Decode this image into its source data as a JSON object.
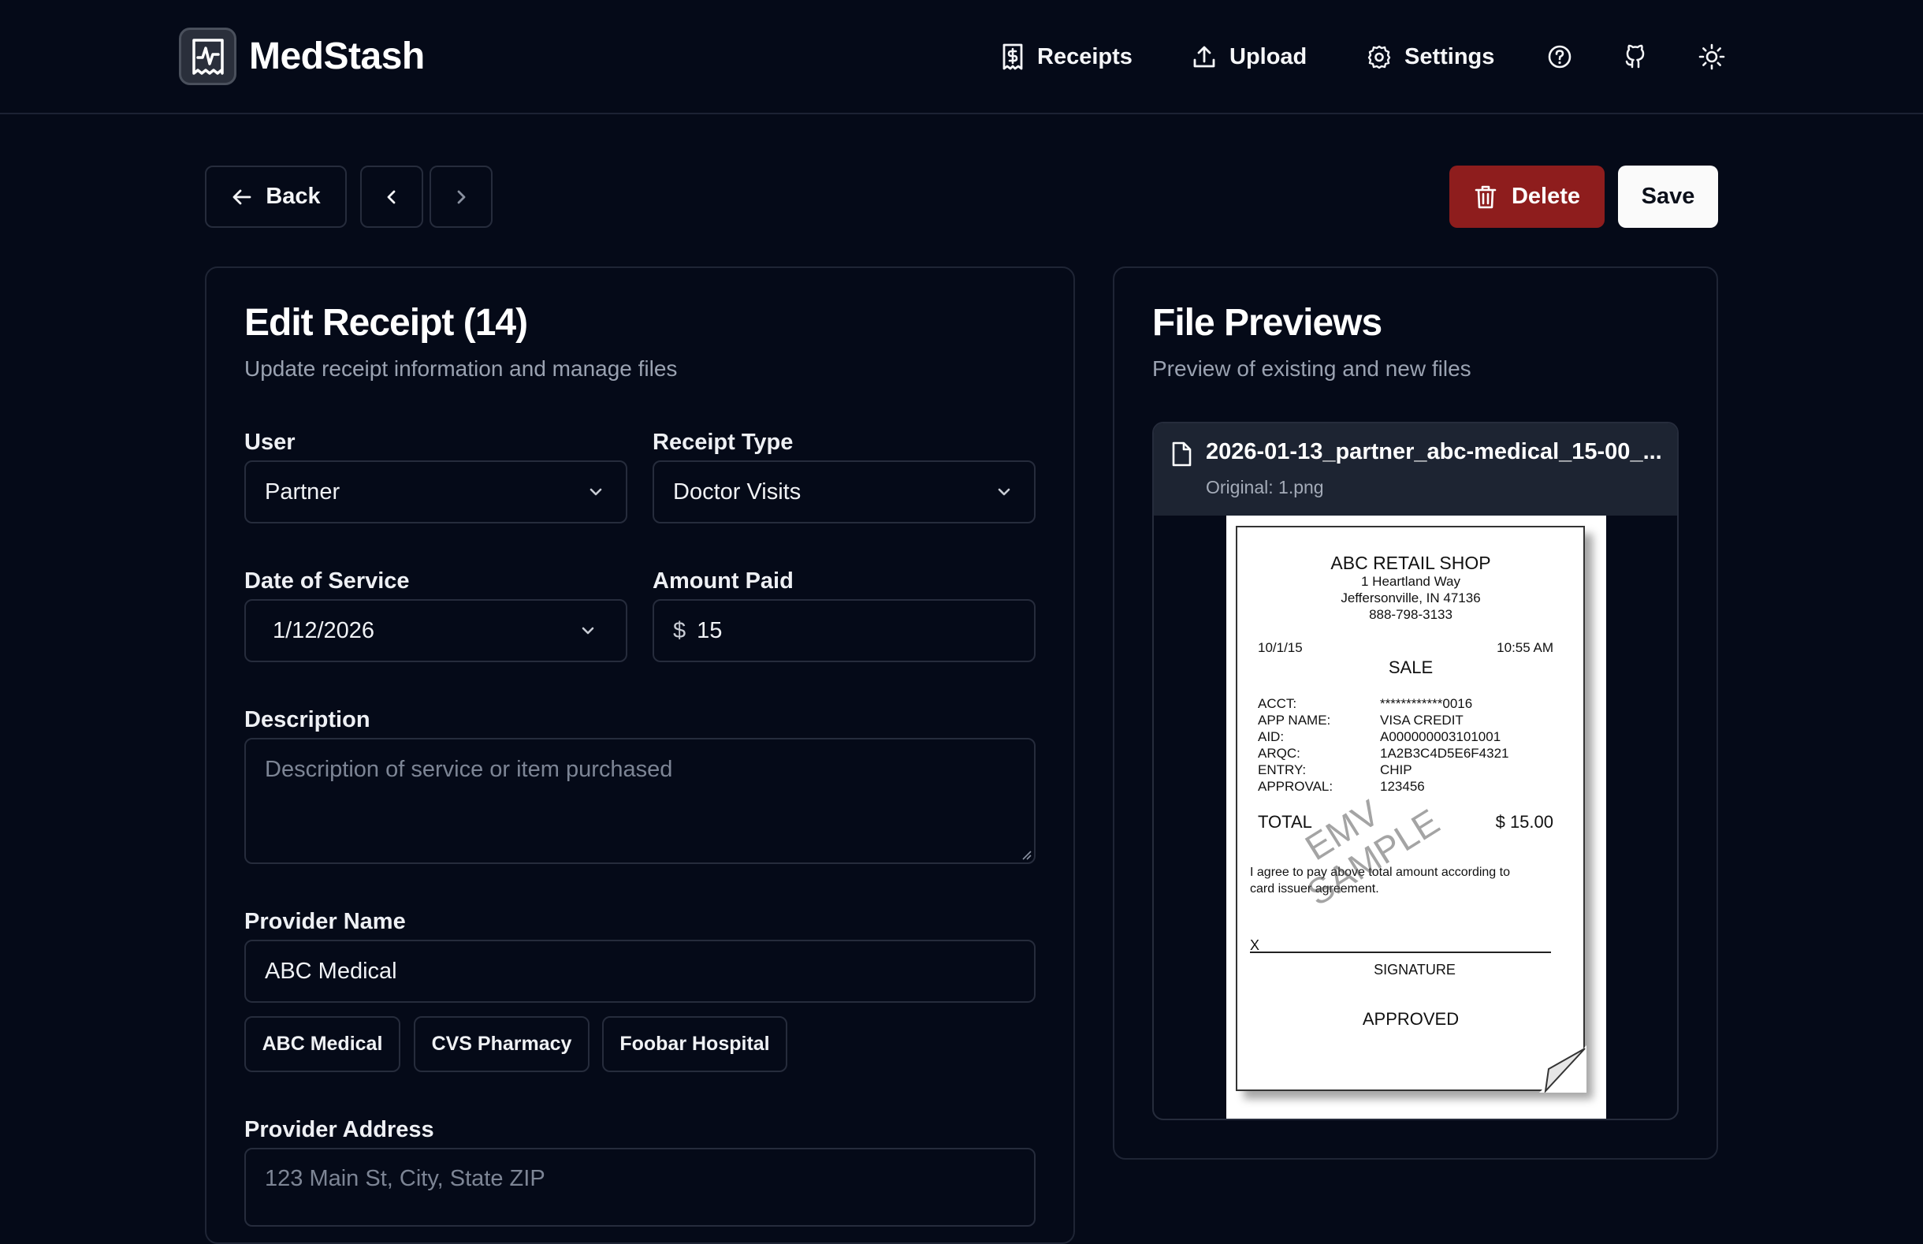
{
  "app": {
    "name": "MedStash",
    "logo_icon": "receipt-pulse-icon"
  },
  "nav": {
    "receipts_label": "Receipts",
    "upload_label": "Upload",
    "settings_label": "Settings",
    "icons": [
      "help-circle-icon",
      "github-icon",
      "sun-icon"
    ]
  },
  "toolbar": {
    "back_label": "Back",
    "delete_label": "Delete",
    "save_label": "Save"
  },
  "form": {
    "title": "Edit Receipt (14)",
    "subtitle": "Update receipt information and manage files",
    "user_label": "User",
    "user_value": "Partner",
    "receipt_type_label": "Receipt Type",
    "receipt_type_value": "Doctor Visits",
    "date_label": "Date of Service",
    "date_value": "1/12/2026",
    "amount_label": "Amount Paid",
    "amount_currency": "$",
    "amount_value": "15",
    "description_label": "Description",
    "description_placeholder": "Description of service or item purchased",
    "provider_name_label": "Provider Name",
    "provider_name_value": "ABC Medical",
    "provider_suggestions": [
      "ABC Medical",
      "CVS Pharmacy",
      "Foobar Hospital"
    ],
    "provider_address_label": "Provider Address",
    "provider_address_placeholder": "123 Main St, City, State ZIP"
  },
  "previews": {
    "title": "File Previews",
    "subtitle": "Preview of existing and new files",
    "file_name": "2026-01-13_partner_abc-medical_15-00_...",
    "original": "Original: 1.png"
  },
  "receipt_image": {
    "shop": "ABC RETAIL SHOP",
    "address1": "1 Heartland Way",
    "address2": "Jeffersonville, IN 47136",
    "phone": "888-798-3133",
    "date": "10/1/15",
    "time": "10:55  AM",
    "sale": "SALE",
    "rows": [
      {
        "k": "ACCT:",
        "v": "************0016"
      },
      {
        "k": "APP NAME:",
        "v": "VISA CREDIT"
      },
      {
        "k": "AID:",
        "v": "A000000003101001"
      },
      {
        "k": "ARQC:",
        "v": "1A2B3C4D5E6F4321"
      },
      {
        "k": "ENTRY:",
        "v": "CHIP"
      },
      {
        "k": "APPROVAL:",
        "v": "123456"
      }
    ],
    "total_label": "TOTAL",
    "total_value": "$  15.00",
    "agree_line1": "I agree to pay above total amount according to",
    "agree_line2": "card issuer agreement.",
    "x_mark": "X",
    "signature": "SIGNATURE",
    "approved": "APPROVED",
    "watermark_line1": "EMV",
    "watermark_line2": "SAMPLE"
  }
}
